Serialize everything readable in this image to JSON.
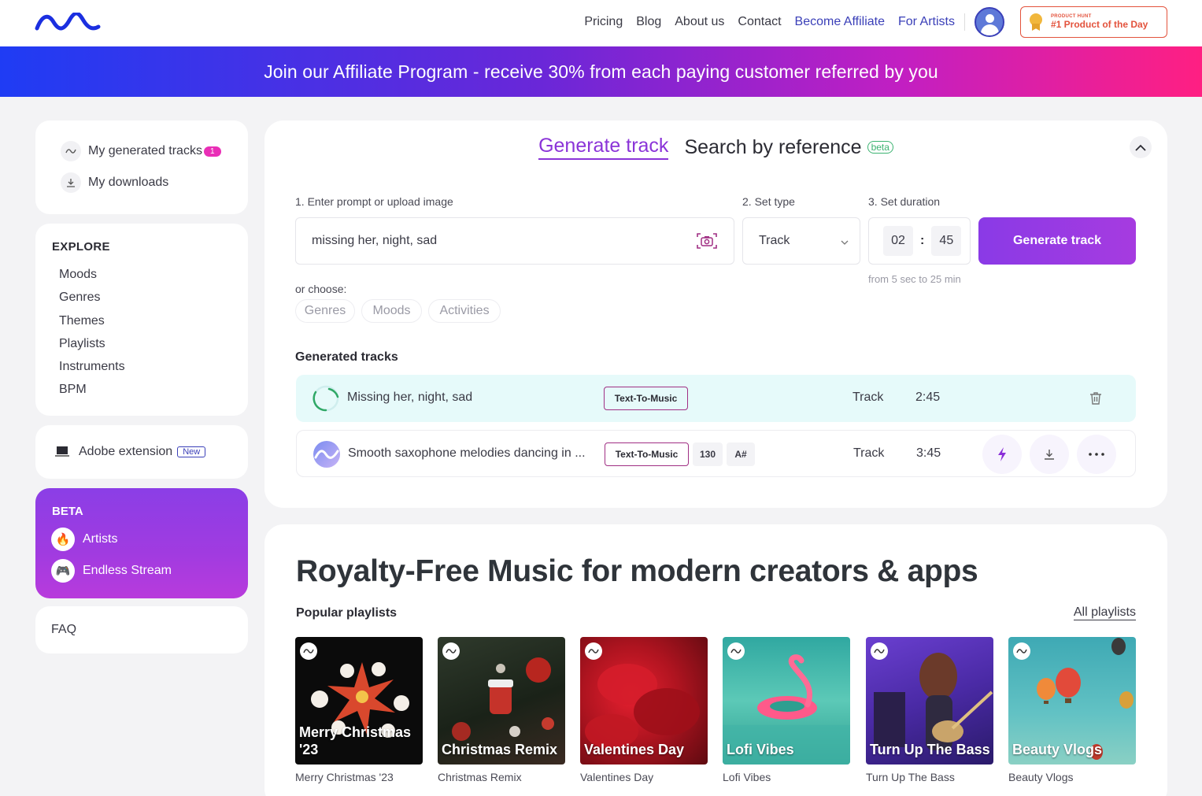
{
  "header": {
    "nav": [
      "Pricing",
      "Blog",
      "About us",
      "Contact"
    ],
    "affiliate": "Become Affiliate",
    "artists": "For Artists",
    "ph_small": "PRODUCT HUNT",
    "ph_big": "#1 Product of the Day"
  },
  "banner": {
    "text": "Join our Affiliate Program - receive 30% from each paying customer referred by you"
  },
  "sidebar": {
    "my_tracks": "My generated tracks",
    "my_tracks_count": "1",
    "my_downloads": "My downloads",
    "explore_title": "EXPLORE",
    "explore": [
      "Moods",
      "Genres",
      "Themes",
      "Playlists",
      "Instruments",
      "BPM"
    ],
    "adobe": "Adobe extension",
    "adobe_tag": "New",
    "beta_title": "BETA",
    "artists": "Artists",
    "stream": "Endless Stream",
    "faq": "FAQ"
  },
  "generator": {
    "tab_generate": "Generate track",
    "tab_search": "Search by reference",
    "tab_search_badge": "beta",
    "label_prompt": "1. Enter prompt or upload image",
    "prompt_value": "missing her, night, sad",
    "label_type": "2. Set type",
    "type_value": "Track",
    "label_duration": "3. Set duration",
    "dur_min": "02",
    "dur_sec": "45",
    "dur_hint": "from 5 sec to 25 min",
    "button": "Generate track",
    "or_choose": "or choose:",
    "chips": [
      "Genres",
      "Moods",
      "Activities"
    ],
    "generated_title": "Generated tracks",
    "tracks": [
      {
        "name": "Missing her, night, sad",
        "tag": "Text-To-Music",
        "type": "Track",
        "duration": "2:45"
      },
      {
        "name": "Smooth saxophone melodies dancing in ...",
        "tag": "Text-To-Music",
        "bpm": "130",
        "key": "A#",
        "type": "Track",
        "duration": "3:45"
      }
    ]
  },
  "royalty": {
    "title": "Royalty-Free Music for modern creators & apps",
    "popular": "Popular playlists",
    "all": "All playlists",
    "playlists": [
      {
        "overlay": "Merry Christmas '23",
        "caption": "Merry Christmas '23"
      },
      {
        "overlay": "Christmas Remix",
        "caption": "Christmas Remix"
      },
      {
        "overlay": "Valentines Day",
        "caption": "Valentines Day"
      },
      {
        "overlay": "Lofi Vibes",
        "caption": "Lofi Vibes"
      },
      {
        "overlay": "Turn Up The Bass",
        "caption": "Turn Up The Bass"
      },
      {
        "overlay": "Beauty Vlogs",
        "caption": "Beauty Vlogs"
      }
    ]
  },
  "colors": {
    "accent": "#8b34d8",
    "nav_accent": "#3a3fb8",
    "pink": "#e92fb6"
  }
}
